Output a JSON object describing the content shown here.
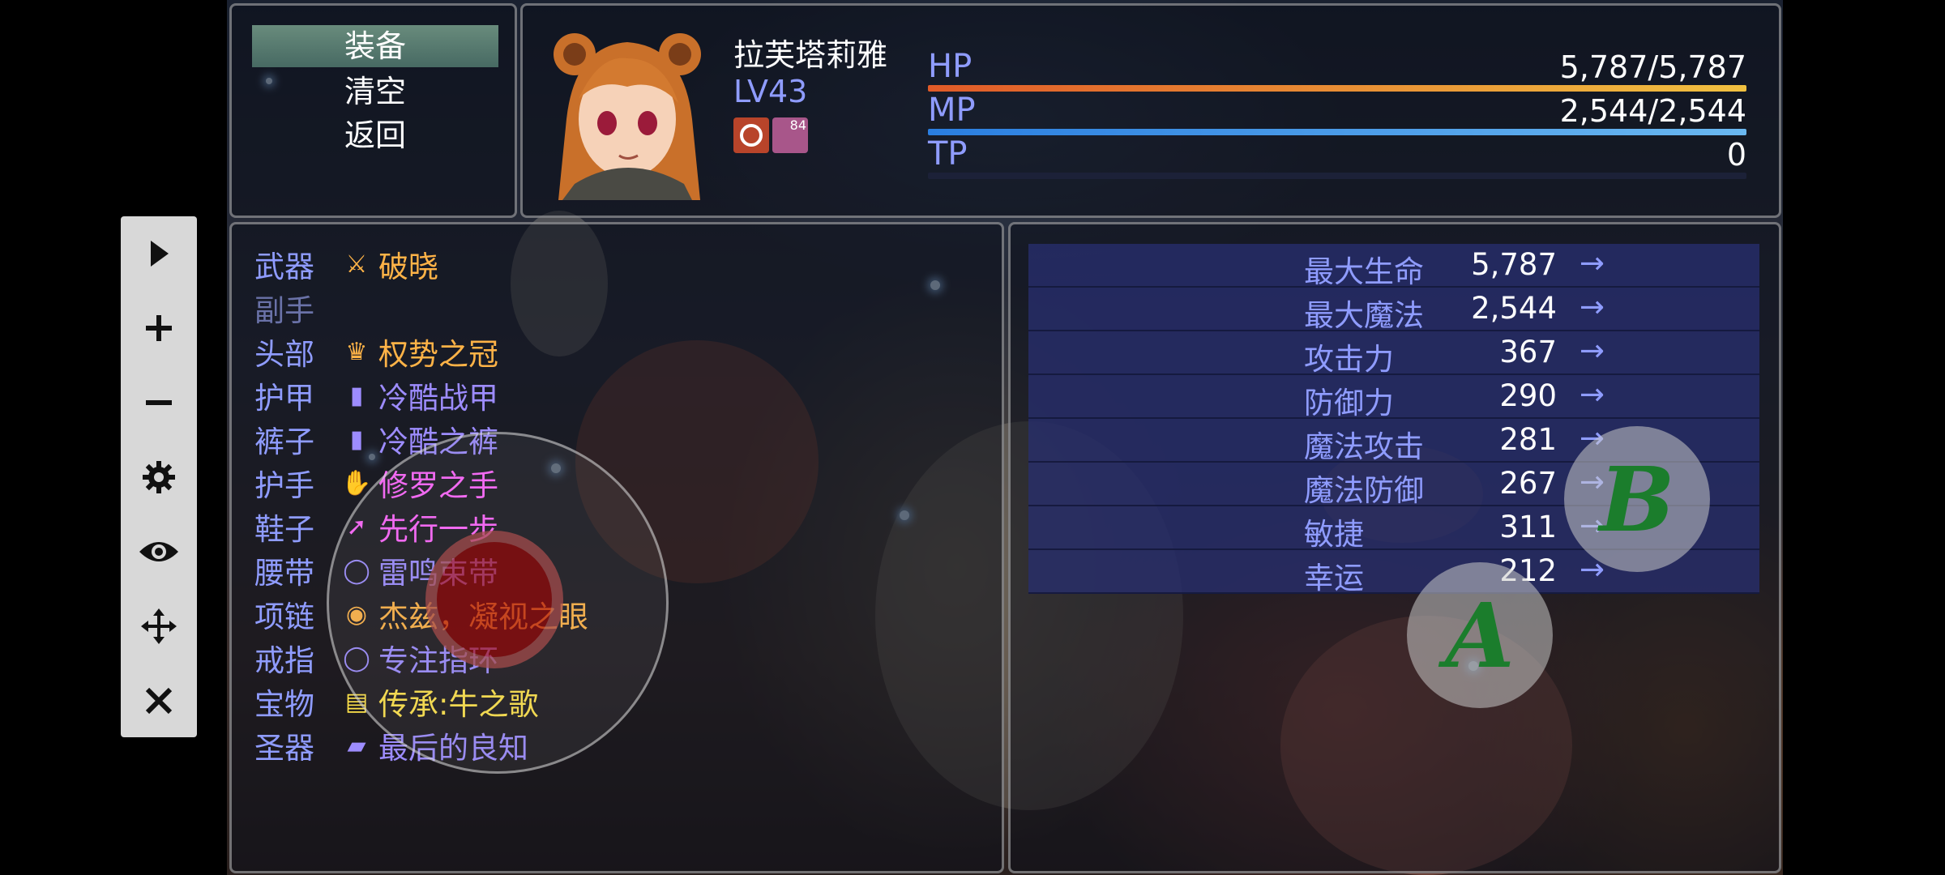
{
  "command_window": {
    "items": [
      {
        "label": "装备",
        "selected": true
      },
      {
        "label": "清空",
        "selected": false
      },
      {
        "label": "返回",
        "selected": false
      }
    ]
  },
  "status": {
    "name": "拉芙塔莉雅",
    "level": "LV43",
    "state_badge": "84",
    "hp": {
      "label": "HP",
      "text": "5,787/5,787",
      "fraction": 1.0,
      "color_start": "#e05a28",
      "color_end": "#f0c040"
    },
    "mp": {
      "label": "MP",
      "text": "2,544/2,544",
      "fraction": 1.0,
      "color_start": "#2a7ee0",
      "color_end": "#6ab8f0"
    },
    "tp": {
      "label": "TP",
      "text": "0",
      "fraction": 0.0,
      "color_start": "#30a030",
      "color_end": "#80e080"
    }
  },
  "equipment": [
    {
      "slot": "武器",
      "icon": "dagger-icon",
      "glyph": "⚔",
      "item": "破晓",
      "color": "#ffb347"
    },
    {
      "slot": "副手",
      "icon": "",
      "glyph": "",
      "item": "",
      "color": "#ffffff",
      "slot_dim": true
    },
    {
      "slot": "头部",
      "icon": "crown-icon",
      "glyph": "♛",
      "item": "权势之冠",
      "color": "#ffb347"
    },
    {
      "slot": "护甲",
      "icon": "armor-icon",
      "glyph": "▮",
      "item": "冷酷战甲",
      "color": "#9d8cff"
    },
    {
      "slot": "裤子",
      "icon": "pants-icon",
      "glyph": "▮",
      "item": "冷酷之裤",
      "color": "#9d8cff"
    },
    {
      "slot": "护手",
      "icon": "gauntlet-icon",
      "glyph": "✋",
      "item": "修罗之手",
      "color": "#ff66ff"
    },
    {
      "slot": "鞋子",
      "icon": "boot-icon",
      "glyph": "➚",
      "item": "先行一步",
      "color": "#ff66ff"
    },
    {
      "slot": "腰带",
      "icon": "belt-icon",
      "glyph": "◯",
      "item": "雷鸣束带",
      "color": "#9d8cff"
    },
    {
      "slot": "项链",
      "icon": "amulet-icon",
      "glyph": "◉",
      "item": "杰兹，凝视之眼",
      "color": "#ffb347"
    },
    {
      "slot": "戒指",
      "icon": "ring-icon",
      "glyph": "◯",
      "item": "专注指环",
      "color": "#9d8cff"
    },
    {
      "slot": "宝物",
      "icon": "scroll-icon",
      "glyph": "▤",
      "item": "传承:牛之歌",
      "color": "#ffe34a"
    },
    {
      "slot": "圣器",
      "icon": "relic-icon",
      "glyph": "▰",
      "item": "最后的良知",
      "color": "#9d8cff"
    }
  ],
  "params": [
    {
      "name": "最大生命",
      "value": "5,787",
      "arrow": "→"
    },
    {
      "name": "最大魔法",
      "value": "2,544",
      "arrow": "→"
    },
    {
      "name": "攻击力",
      "value": "367",
      "arrow": "→"
    },
    {
      "name": "防御力",
      "value": "290",
      "arrow": "→"
    },
    {
      "name": "魔法攻击",
      "value": "281",
      "arrow": "→"
    },
    {
      "name": "魔法防御",
      "value": "267",
      "arrow": "→"
    },
    {
      "name": "敏捷",
      "value": "311",
      "arrow": "→"
    },
    {
      "name": "幸运",
      "value": "212",
      "arrow": "→"
    }
  ],
  "toolbar": {
    "buttons": [
      {
        "name": "play-icon",
        "glyph": "▶"
      },
      {
        "name": "plus-icon",
        "glyph": "+"
      },
      {
        "name": "minus-icon",
        "glyph": "−"
      },
      {
        "name": "gear-icon",
        "glyph": "⚙"
      },
      {
        "name": "eye-icon",
        "glyph": "◉"
      },
      {
        "name": "move-icon",
        "glyph": "✥"
      },
      {
        "name": "close-icon",
        "glyph": "✕"
      }
    ]
  },
  "touch_buttons": {
    "a_label": "A",
    "b_label": "B"
  }
}
